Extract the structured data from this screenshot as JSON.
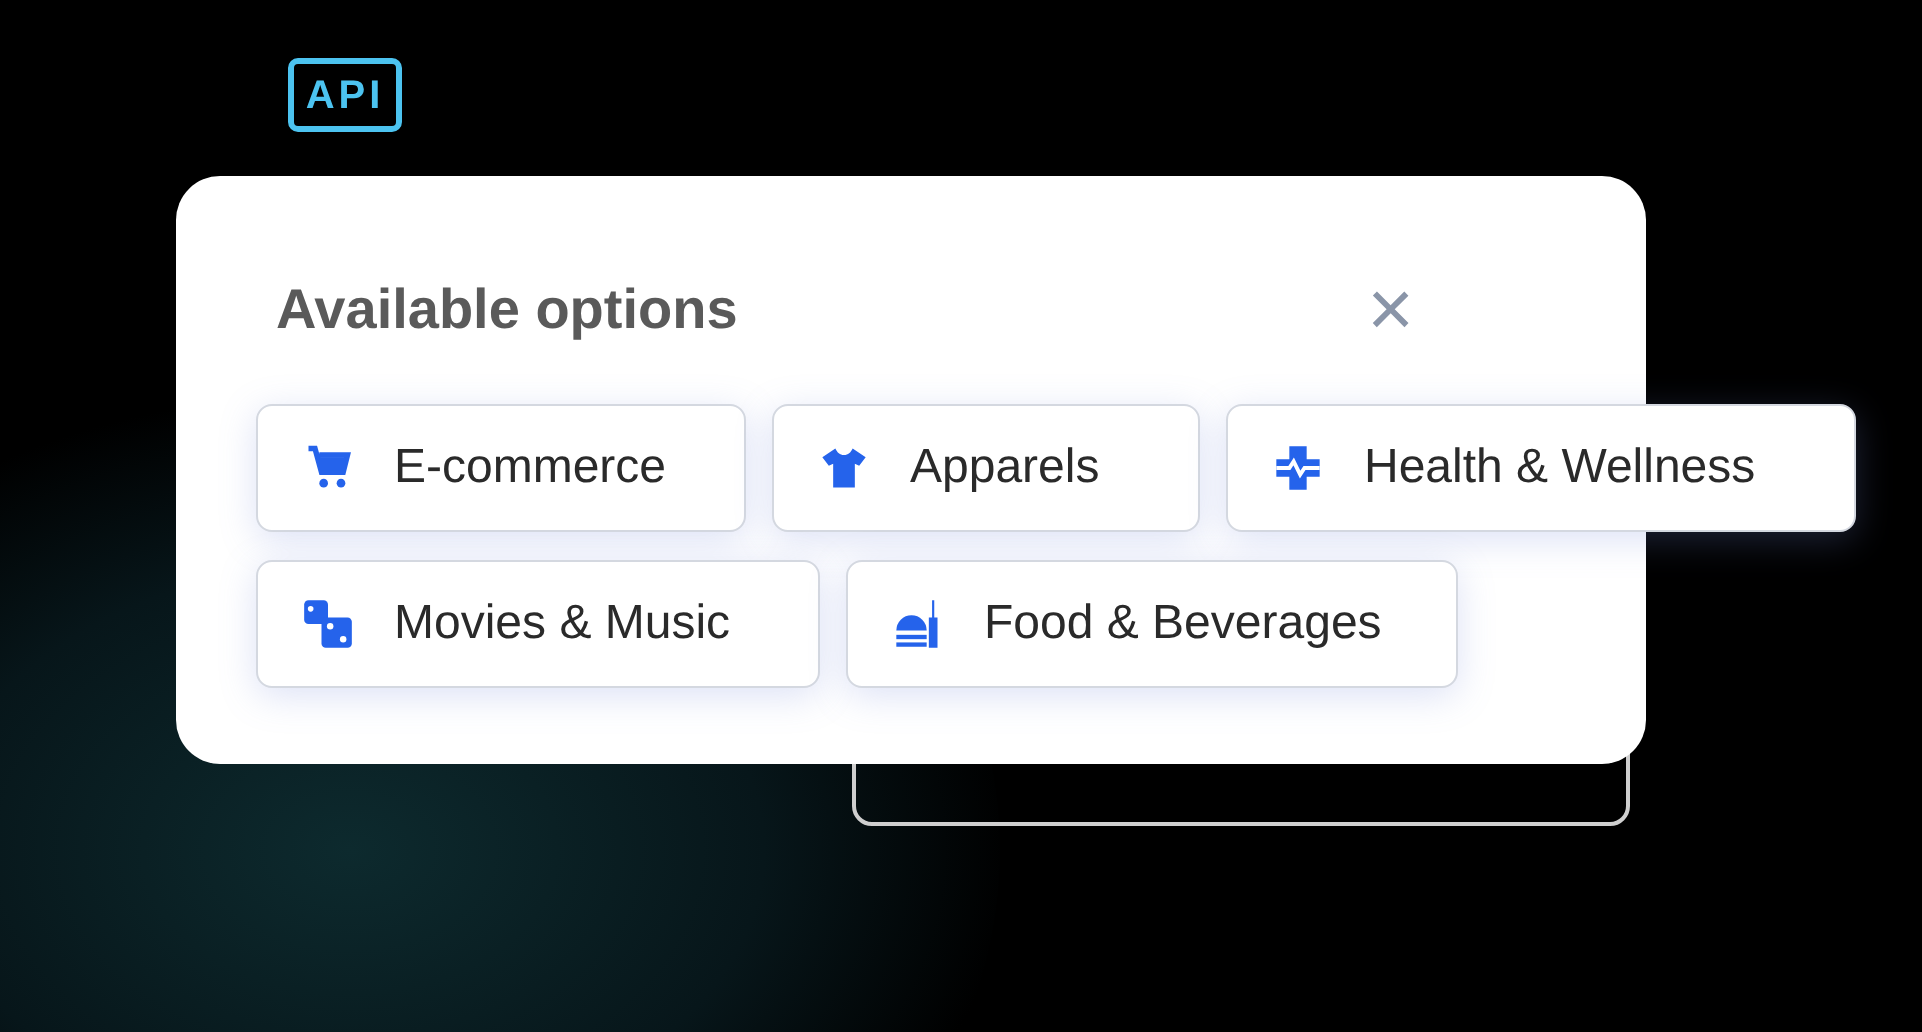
{
  "badge": "API",
  "dialog": {
    "title": "Available options",
    "close": "×",
    "option_rows": [
      [
        {
          "label": "E-commerce"
        },
        {
          "label": "Apparels"
        },
        {
          "label": "Health & Wellness"
        }
      ],
      [
        {
          "label": "Movies & Music"
        },
        {
          "label": "Food & Beverages"
        }
      ]
    ]
  }
}
